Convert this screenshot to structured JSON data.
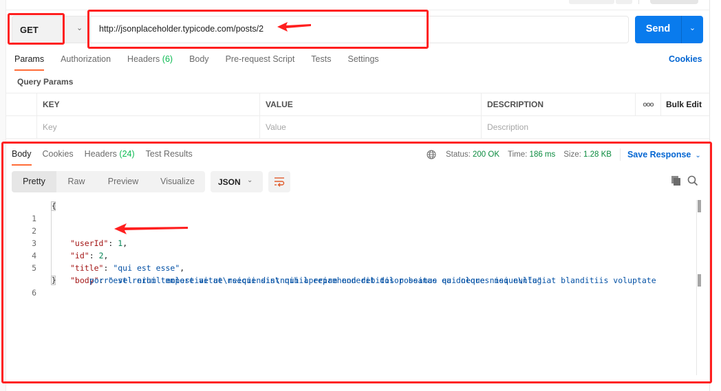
{
  "request": {
    "method": "GET",
    "url": "http://jsonplaceholder.typicode.com/posts/2",
    "send_label": "Send"
  },
  "request_tabs": [
    {
      "label": "Params",
      "active": true
    },
    {
      "label": "Authorization"
    },
    {
      "label": "Headers",
      "count": "(6)"
    },
    {
      "label": "Body"
    },
    {
      "label": "Pre-request Script"
    },
    {
      "label": "Tests"
    },
    {
      "label": "Settings"
    }
  ],
  "cookies_label": "Cookies",
  "query_params": {
    "title": "Query Params",
    "columns": {
      "key": "KEY",
      "value": "VALUE",
      "description": "DESCRIPTION",
      "more": "ooo",
      "bulk_edit": "Bulk Edit"
    },
    "placeholders": {
      "key": "Key",
      "value": "Value",
      "description": "Description"
    }
  },
  "response": {
    "tabs": [
      {
        "label": "Body",
        "active": true
      },
      {
        "label": "Cookies"
      },
      {
        "label": "Headers",
        "count": "(24)"
      },
      {
        "label": "Test Results"
      }
    ],
    "status_label": "Status:",
    "status_value": "200 OK",
    "time_label": "Time:",
    "time_value": "186 ms",
    "size_label": "Size:",
    "size_value": "1.28 KB",
    "save_label": "Save Response",
    "views": [
      "Pretty",
      "Raw",
      "Preview",
      "Visualize"
    ],
    "active_view": "Pretty",
    "format": "JSON",
    "code_lines": [
      {
        "n": "1",
        "open": "{"
      },
      {
        "n": "2",
        "key": "\"userId\"",
        "num": "1"
      },
      {
        "n": "3",
        "key": "\"id\"",
        "num": "2"
      },
      {
        "n": "4",
        "key": "\"title\"",
        "str": "\"qui est esse\""
      },
      {
        "n": "5",
        "key": "\"body\"",
        "str": "\"est rerum tempore vitae\\nsequi sint nihil reprehenderit dolor beatae ea dolores neque\\nfugiat blanditiis voluptate",
        "str2": "porro vel nihil molestiae ut reiciendis\\nqui aperiam non debitis possimus qui neque nisi nulla\""
      },
      {
        "n": "6",
        "close": "}"
      }
    ]
  },
  "colors": {
    "accent_orange": "#ff6c37",
    "send_blue": "#097bed",
    "link_blue": "#0265d2",
    "status_green": "#0a8a3e",
    "annotation_red": "#ff1f1f"
  }
}
